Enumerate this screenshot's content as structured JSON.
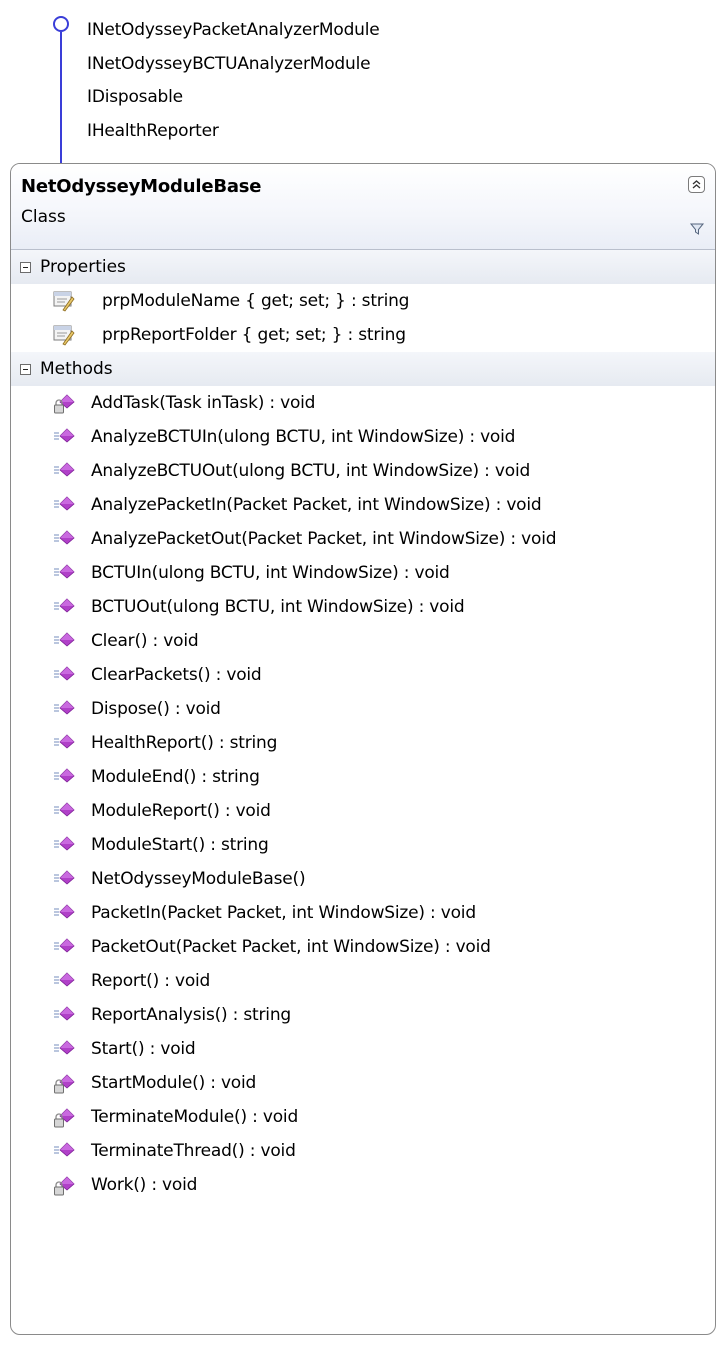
{
  "interfaces": [
    "INetOdysseyPacketAnalyzerModule",
    "INetOdysseyBCTUAnalyzerModule",
    "IDisposable",
    "IHealthReporter"
  ],
  "class": {
    "name": "NetOdysseyModuleBase",
    "kind": "Class"
  },
  "sections": {
    "properties": {
      "title": "Properties",
      "items": [
        {
          "label": "prpModuleName { get; set; } : string",
          "icon": "property-icon"
        },
        {
          "label": "prpReportFolder { get; set; } : string",
          "icon": "property-icon"
        }
      ]
    },
    "methods": {
      "title": "Methods",
      "items": [
        {
          "label": "AddTask(Task inTask) : void",
          "icon": "protected-method-icon"
        },
        {
          "label": "AnalyzeBCTUIn(ulong BCTU, int WindowSize) : void",
          "icon": "public-method-icon"
        },
        {
          "label": "AnalyzeBCTUOut(ulong BCTU, int WindowSize) : void",
          "icon": "public-method-icon"
        },
        {
          "label": "AnalyzePacketIn(Packet Packet, int WindowSize) : void",
          "icon": "public-method-icon"
        },
        {
          "label": "AnalyzePacketOut(Packet Packet, int WindowSize) : void",
          "icon": "public-method-icon"
        },
        {
          "label": "BCTUIn(ulong BCTU, int WindowSize) : void",
          "icon": "public-method-icon"
        },
        {
          "label": "BCTUOut(ulong BCTU, int WindowSize) : void",
          "icon": "public-method-icon"
        },
        {
          "label": "Clear() : void",
          "icon": "public-method-icon"
        },
        {
          "label": "ClearPackets() : void",
          "icon": "public-method-icon"
        },
        {
          "label": "Dispose() : void",
          "icon": "public-method-icon"
        },
        {
          "label": "HealthReport() : string",
          "icon": "public-method-icon"
        },
        {
          "label": "ModuleEnd() : string",
          "icon": "public-method-icon"
        },
        {
          "label": "ModuleReport() : void",
          "icon": "public-method-icon"
        },
        {
          "label": "ModuleStart() : string",
          "icon": "public-method-icon"
        },
        {
          "label": "NetOdysseyModuleBase()",
          "icon": "public-method-icon"
        },
        {
          "label": "PacketIn(Packet Packet, int WindowSize) : void",
          "icon": "public-method-icon"
        },
        {
          "label": "PacketOut(Packet Packet, int WindowSize) : void",
          "icon": "public-method-icon"
        },
        {
          "label": "Report() : void",
          "icon": "public-method-icon"
        },
        {
          "label": "ReportAnalysis() : string",
          "icon": "public-method-icon"
        },
        {
          "label": "Start() : void",
          "icon": "public-method-icon"
        },
        {
          "label": "StartModule() : void",
          "icon": "protected-method-icon"
        },
        {
          "label": "TerminateModule() : void",
          "icon": "protected-method-icon"
        },
        {
          "label": "TerminateThread() : void",
          "icon": "public-method-icon"
        },
        {
          "label": "Work() : void",
          "icon": "protected-method-icon"
        }
      ]
    }
  },
  "colors": {
    "interface_line": "#3a3ed8",
    "method_purple": "#b040c8",
    "public_marker": "#a9b7d6",
    "lock_gray": "#8a8a8a",
    "property_yellow": "#e8c86a"
  }
}
